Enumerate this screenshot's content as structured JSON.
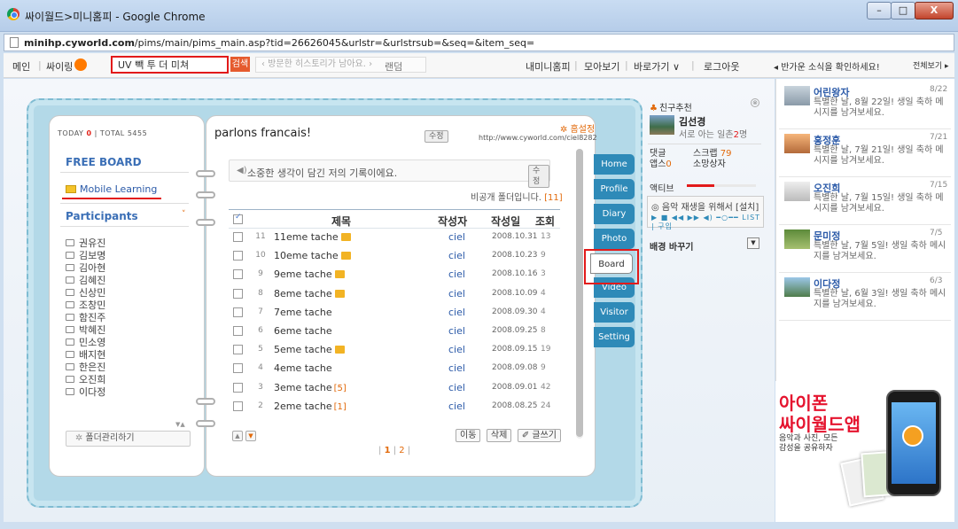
{
  "window": {
    "title": "싸이월드>미니홈피 - Google Chrome",
    "min": "–",
    "max": "□",
    "close": "X"
  },
  "address": {
    "host": "minihp.cyworld.com",
    "path": "/pims/main/pims_main.asp?tid=26626045&urlstr=&urlstrsub=&seq=&item_seq="
  },
  "topnav": {
    "main": "메인",
    "sep": "|",
    "sairing": "싸이링",
    "search_value": "UV 빽 투 더 미쳐",
    "search_button": "검색",
    "history": "‹ 방문한 히스토리가 남아요. ›",
    "random": "랜덤",
    "my_minihome": "내미니홈피",
    "collection": "모아보기",
    "shortcuts": "바로가기 ∨",
    "logout": "로그아웃",
    "news": "◂ 반가운 소식을 확인하세요!",
    "view_all": "전체보기 ▸"
  },
  "minihome": {
    "today_label": "TODAY",
    "today_value": "0",
    "stats_sep": "|",
    "total_label": "TOTAL",
    "total_value": "5455",
    "title": "parlons francais!",
    "edit": "수정",
    "home_setting": "✲ 홈설정",
    "home_url": "http://www.cyworld.com/ciel8282"
  },
  "left_menu": {
    "heading": "FREE BOARD",
    "folder": "Mobile Learning",
    "participants_heading": "Participants",
    "participants_chevron": "˅",
    "participants": [
      "권유진",
      "김보명",
      "김아현",
      "김혜진",
      "신상민",
      "조창민",
      "함진주",
      "박혜진",
      "민소영",
      "배지현",
      "한은진",
      "오진희",
      "이다정"
    ],
    "scroll_arrows": "▼▲",
    "manage_gear": "✲",
    "manage_button": "폴더관리하기"
  },
  "board": {
    "speaker_icon": "◀)",
    "intro": "소중한 생각이 담긴 저의 기록이에요.",
    "edit": "수정",
    "private_folder": "비공개 폴더입니다.",
    "private_count": "[11]",
    "headers": {
      "title": "제목",
      "author": "작성자",
      "date": "작성일",
      "views": "조회"
    },
    "rows": [
      {
        "num": "11",
        "title": "11eme tache",
        "new_icon": true,
        "comments": "",
        "author": "ciel",
        "date": "2008.10.31",
        "views": "13"
      },
      {
        "num": "10",
        "title": "10eme tache",
        "new_icon": true,
        "comments": "",
        "author": "ciel",
        "date": "2008.10.23",
        "views": "9"
      },
      {
        "num": "9",
        "title": "9eme tache",
        "new_icon": true,
        "comments": "",
        "author": "ciel",
        "date": "2008.10.16",
        "views": "3"
      },
      {
        "num": "8",
        "title": "8eme tache",
        "new_icon": true,
        "comments": "",
        "author": "ciel",
        "date": "2008.10.09",
        "views": "4"
      },
      {
        "num": "7",
        "title": "7eme tache",
        "new_icon": false,
        "comments": "",
        "author": "ciel",
        "date": "2008.09.30",
        "views": "4"
      },
      {
        "num": "6",
        "title": "6eme tache",
        "new_icon": false,
        "comments": "",
        "author": "ciel",
        "date": "2008.09.25",
        "views": "8"
      },
      {
        "num": "5",
        "title": "5eme tache",
        "new_icon": true,
        "comments": "",
        "author": "ciel",
        "date": "2008.09.15",
        "views": "19"
      },
      {
        "num": "4",
        "title": "4eme tache",
        "new_icon": false,
        "comments": "",
        "author": "ciel",
        "date": "2008.09.08",
        "views": "9"
      },
      {
        "num": "3",
        "title": "3eme tache",
        "new_icon": false,
        "comments": "[5]",
        "author": "ciel",
        "date": "2008.09.01",
        "views": "42"
      },
      {
        "num": "2",
        "title": "2eme tache",
        "new_icon": false,
        "comments": "[1]",
        "author": "ciel",
        "date": "2008.08.25",
        "views": "24"
      }
    ],
    "arrow_up": "▲",
    "arrow_down": "▼",
    "move": "이동",
    "delete": "삭제",
    "write": "✐ 글쓰기",
    "pagination_sep": "|",
    "pages": [
      "1",
      "2"
    ]
  },
  "tabs": [
    "Home",
    "Profile",
    "Diary",
    "Photo",
    "Board",
    "Video",
    "Visitor",
    "Setting"
  ],
  "friend_widget": {
    "person_icon": "♣",
    "title": "친구추천",
    "close": "⊗",
    "name": "김선경",
    "mutual_prefix": "서로 아는 일촌",
    "mutual_count": "2",
    "mutual_suffix": "명",
    "comment_label": "댓글",
    "apps_label": "앱스",
    "apps_value": "0",
    "scrap_label": "스크랩",
    "scrap_value": "79",
    "subscriber_label": "소망상자",
    "active_label": "액티브",
    "active_level": 0.4,
    "music_line1": "◎ 음악 재생을 위해서 [설치]",
    "music_line2": "▶ ■ ◀◀ ▶▶ ◀) ━○━━ LIST | 구입",
    "bg_change": "배경 바꾸기",
    "bg_select": "▼"
  },
  "news": [
    {
      "name": "어린왕자",
      "date": "8/22",
      "msg": "특별한 날, 8월 22일! 생일 축하 메시지를 남겨보세요."
    },
    {
      "name": "홍정훈",
      "date": "7/21",
      "msg": "특별한 날, 7월 21일! 생일 축하 메시지를 남겨보세요."
    },
    {
      "name": "오진희",
      "date": "7/15",
      "msg": "특별한 날, 7월 15일! 생일 축하 메시지를 남겨보세요."
    },
    {
      "name": "문미정",
      "date": "7/5",
      "msg": "특별한 날, 7월 5일! 생일 축하 메시지를 남겨보세요."
    },
    {
      "name": "이다정",
      "date": "6/3",
      "msg": "특별한 날, 6월 3일! 생일 축하 메시지를 남겨보세요."
    }
  ],
  "ad": {
    "title1": "아이폰",
    "title2": "싸이월드앱",
    "desc": "음악과 사진, 모든 감성을 공유하자"
  }
}
